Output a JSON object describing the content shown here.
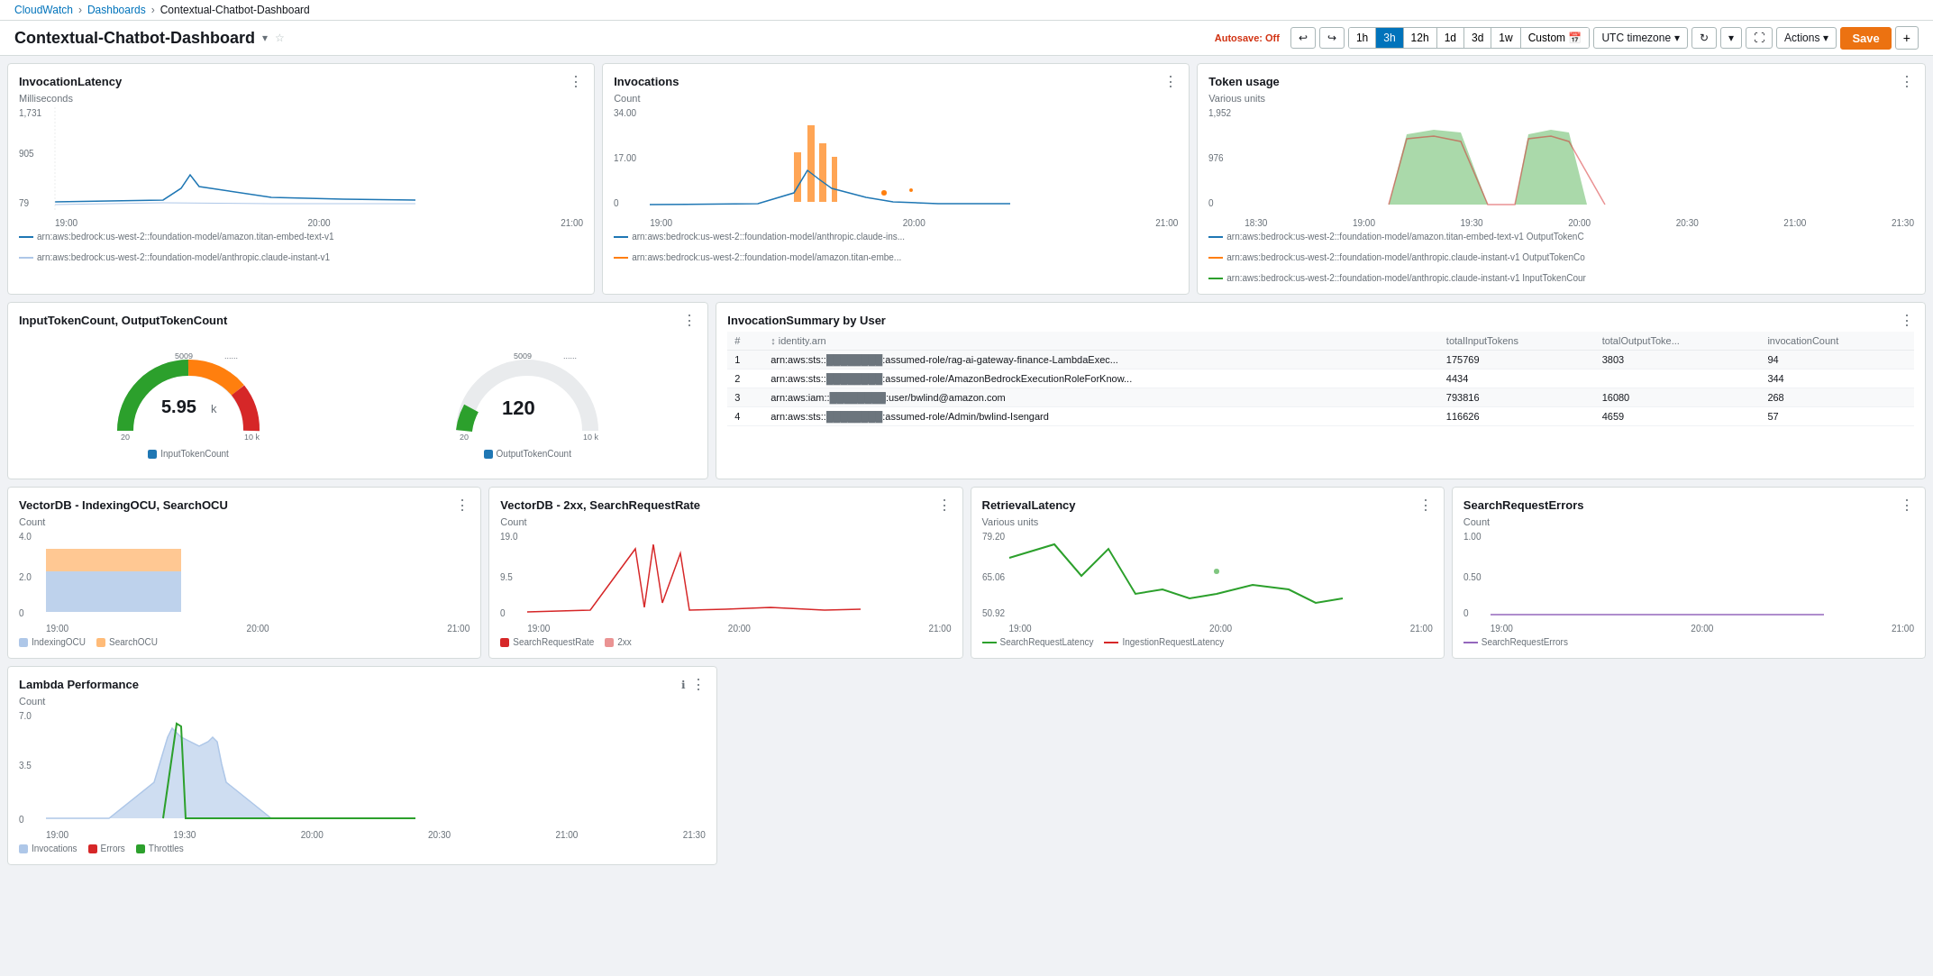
{
  "breadcrumb": {
    "items": [
      "CloudWatch",
      "Dashboards",
      "Contextual-Chatbot-Dashboard"
    ]
  },
  "autosave": {
    "label": "Autosave:",
    "value": "Off"
  },
  "toolbar": {
    "undo_label": "↩",
    "redo_label": "↪",
    "time_buttons": [
      "1h",
      "3h",
      "12h",
      "1d",
      "3d",
      "1w"
    ],
    "active_time": "3h",
    "custom_label": "Custom",
    "timezone_label": "UTC timezone",
    "refresh_label": "↻",
    "dropdown_label": "▾",
    "fullscreen_label": "⛶",
    "actions_label": "Actions",
    "save_label": "Save",
    "add_label": "+"
  },
  "dashboard_title": "Contextual-Chatbot-Dashboard",
  "widgets": {
    "invocation_latency": {
      "title": "InvocationLatency",
      "subtitle": "Milliseconds",
      "y_values": [
        "1,731",
        "905",
        "79"
      ],
      "x_labels": [
        "19:00",
        "20:00",
        "21:00"
      ],
      "legend": [
        {
          "label": "arn:aws:bedrock:us-west-2::foundation-model/amazon.titan-embed-text-v1",
          "color": "#1f77b4"
        },
        {
          "label": "arn:aws:bedrock:us-west-2::foundation-model/anthropic.claude-instant-v1",
          "color": "#aec7e8"
        }
      ]
    },
    "invocations": {
      "title": "Invocations",
      "subtitle": "Count",
      "y_values": [
        "34.00",
        "17.00",
        "0"
      ],
      "x_labels": [
        "19:00",
        "20:00",
        "21:00"
      ],
      "legend": [
        {
          "label": "arn:aws:bedrock:us-west-2::foundation-model/anthropic.claude-ins...",
          "color": "#1f77b4"
        },
        {
          "label": "arn:aws:bedrock:us-west-2::foundation-model/amazon.titan-embe...",
          "color": "#ff7f0e"
        }
      ]
    },
    "token_usage": {
      "title": "Token usage",
      "subtitle": "Various units",
      "y_values": [
        "1,952",
        "976",
        "0"
      ],
      "x_labels": [
        "18:30",
        "19:00",
        "19:30",
        "20:00",
        "20:30",
        "21:00",
        "21:30"
      ],
      "legend": [
        {
          "label": "arn:aws:bedrock:us-west-2::foundation-model/amazon.titan-embed-text-v1 OutputTokenC",
          "color": "#1f77b4"
        },
        {
          "label": "arn:aws:bedrock:us-west-2::foundation-model/anthropic.claude-instant-v1 OutputTokenCo",
          "color": "#ff7f0e"
        },
        {
          "label": "arn:aws:bedrock:us-west-2::foundation-model/anthropic.claude-instant-v1 InputTokenCour",
          "color": "#2ca02c"
        }
      ]
    },
    "input_output_token": {
      "title": "InputTokenCount, OutputTokenCount",
      "gauge1": {
        "value": "5.95",
        "unit": "k",
        "label": "InputTokenCount",
        "min": "20",
        "max_inner": "8000",
        "max_outer": "5009",
        "max_far": "10 k"
      },
      "gauge2": {
        "value": "120",
        "label": "OutputTokenCount",
        "min": "20",
        "max_inner": "8000",
        "max_outer": "5009",
        "max_far": "10 k"
      }
    },
    "invocation_summary": {
      "title": "InvocationSummary by User",
      "columns": [
        "#",
        "identity.arn",
        "totalInputTokens",
        "totalOutputToke...",
        "invocationCount"
      ],
      "rows": [
        {
          "num": "1",
          "arn": "arn:aws:sts::[REDACTED]:assumed-role/rag-ai-gateway-finance-LambdaExec...",
          "inputTokens": "175769",
          "outputTokens": "3803",
          "invCount": "94"
        },
        {
          "num": "2",
          "arn": "arn:aws:sts::[REDACTED]:assumed-role/AmazonBedrockExecutionRoleForKnow...",
          "inputTokens": "4434",
          "outputTokens": "",
          "invCount": "344"
        },
        {
          "num": "3",
          "arn": "arn:aws:iam::[REDACTED]:user/bwlind@amazon.com",
          "inputTokens": "793816",
          "outputTokens": "16080",
          "invCount": "268"
        },
        {
          "num": "4",
          "arn": "arn:aws:sts::[REDACTED]:assumed-role/Admin/bwlind-Isengard",
          "inputTokens": "116626",
          "outputTokens": "4659",
          "invCount": "57"
        }
      ]
    },
    "vectordb_indexing": {
      "title": "VectorDB - IndexingOCU, SearchOCU",
      "subtitle": "Count",
      "y_values": [
        "4.0",
        "2.0",
        "0"
      ],
      "x_labels": [
        "19:00",
        "20:00",
        "21:00"
      ],
      "legend": [
        {
          "label": "IndexingOCU",
          "color": "#aec7e8"
        },
        {
          "label": "SearchOCU",
          "color": "#ffbb78"
        }
      ]
    },
    "vectordb_search": {
      "title": "VectorDB - 2xx, SearchRequestRate",
      "subtitle": "Count",
      "y_values": [
        "19.0",
        "9.5",
        "0"
      ],
      "x_labels": [
        "19:00",
        "20:00",
        "21:00"
      ],
      "legend": [
        {
          "label": "SearchRequestRate",
          "color": "#d62728"
        },
        {
          "label": "2xx",
          "color": "#d62728"
        }
      ]
    },
    "retrieval_latency": {
      "title": "RetrievalLatency",
      "subtitle": "Various units",
      "y_values": [
        "79.20",
        "65.06",
        "50.92"
      ],
      "x_labels": [
        "19:00",
        "20:00",
        "21:00"
      ],
      "legend": [
        {
          "label": "SearchRequestLatency",
          "color": "#2ca02c"
        },
        {
          "label": "IngestionRequestLatency",
          "color": "#d62728"
        }
      ]
    },
    "search_request_errors": {
      "title": "SearchRequestErrors",
      "subtitle": "Count",
      "y_values": [
        "1.00",
        "0.50",
        "0"
      ],
      "x_labels": [
        "19:00",
        "20:00",
        "21:00"
      ],
      "legend": [
        {
          "label": "SearchRequestErrors",
          "color": "#9467bd"
        }
      ]
    },
    "lambda_performance": {
      "title": "Lambda Performance",
      "subtitle": "Count",
      "y_values": [
        "7.0",
        "3.5",
        "0"
      ],
      "x_labels": [
        "19:00",
        "19:30",
        "20:00",
        "20:30",
        "21:00",
        "21:30"
      ],
      "legend": [
        {
          "label": "Invocations",
          "color": "#aec7e8"
        },
        {
          "label": "Errors",
          "color": "#d62728"
        },
        {
          "label": "Throttles",
          "color": "#2ca02c"
        }
      ]
    }
  }
}
